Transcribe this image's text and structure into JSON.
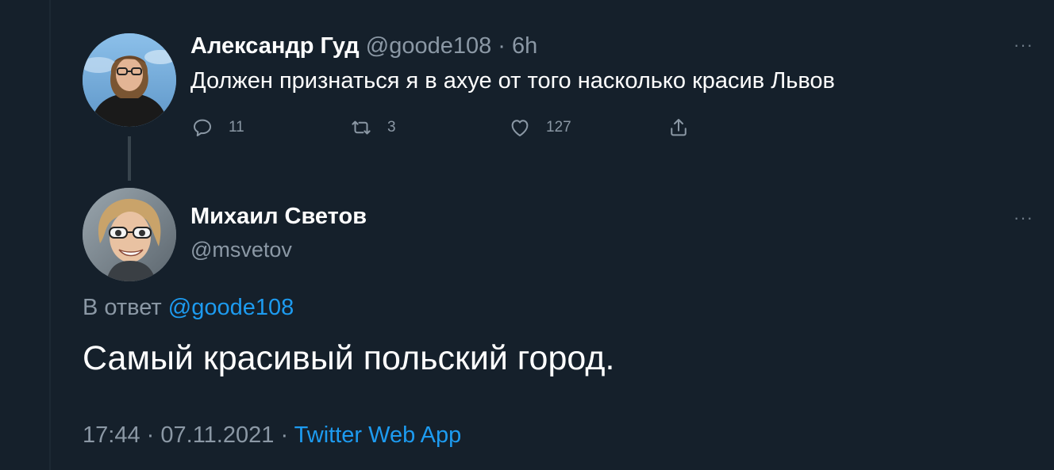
{
  "parent_tweet": {
    "author_name": "Александр Гуд",
    "handle": "@goode108",
    "separator": "·",
    "time": "6h",
    "text": "Должен признаться я в ахуе от того насколько красив Львов",
    "reply_count": "11",
    "retweet_count": "3",
    "like_count": "127",
    "more_label": "···"
  },
  "main_tweet": {
    "author_name": "Михаил Светов",
    "handle": "@msvetov",
    "reply_prefix": "В ответ",
    "reply_handle": "@goode108",
    "text": "Самый красивый польский город.",
    "time": "17:44",
    "separator1": "·",
    "date": "07.11.2021",
    "separator2": "·",
    "source": "Twitter Web App",
    "more_label": "···"
  },
  "colors": {
    "background": "#15202b",
    "link": "#1d9bf0",
    "muted": "#8b98a5"
  },
  "icons": [
    "reply-icon",
    "retweet-icon",
    "like-icon",
    "share-icon",
    "more-icon"
  ]
}
